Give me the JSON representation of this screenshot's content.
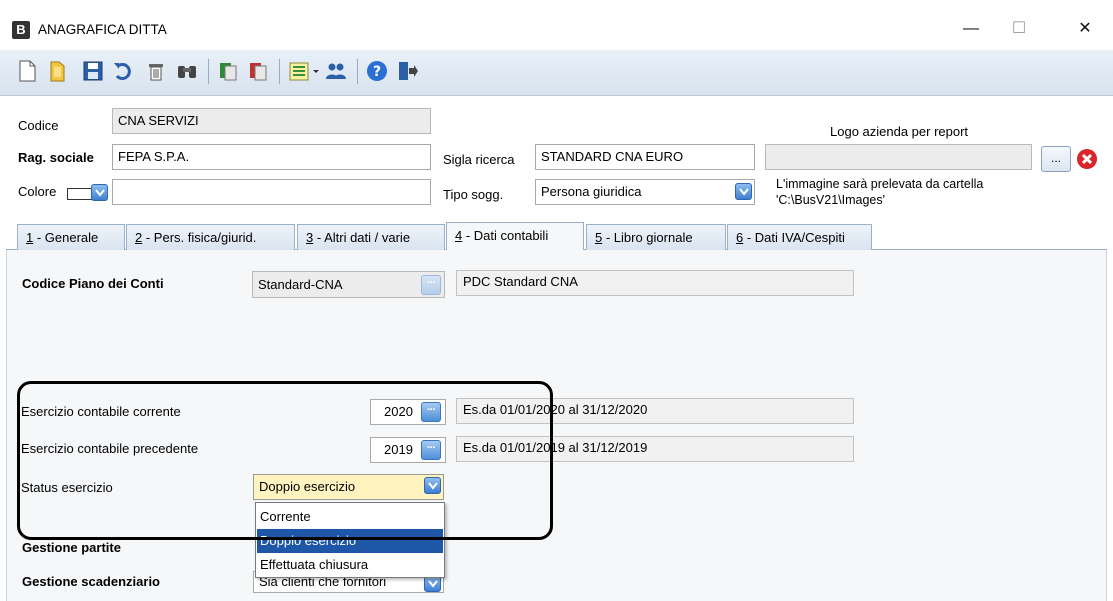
{
  "window": {
    "title": "ANAGRAFICA DITTA",
    "app_icon_letter": "B",
    "minimize": "—",
    "maximize": "☐",
    "close": "✕"
  },
  "toolbar": {
    "icons": [
      "new-icon",
      "open-icon",
      "save-icon",
      "undo-icon",
      "delete-icon",
      "find-icon",
      "copy-icon",
      "paste-icon",
      "list-icon",
      "users-icon",
      "help-icon",
      "exit-icon"
    ]
  },
  "header": {
    "codice_label": "Codice",
    "codice_value": "CNA SERVIZI",
    "rag_sociale_label": "Rag. sociale",
    "rag_sociale_value": "FEPA S.P.A.",
    "colore_label": "Colore",
    "colore_value": "",
    "sigla_label": "Sigla ricerca",
    "sigla_value": "STANDARD CNA EURO",
    "tipo_label": "Tipo sogg.",
    "tipo_value": "Persona giuridica",
    "logo_label": "Logo azienda per report",
    "logo_value": "",
    "logo_browse": "...",
    "logo_note_line1": "L'immagine sarà prelevata da cartella",
    "logo_note_line2": "'C:\\BusV21\\Images'"
  },
  "tabs": [
    {
      "num": "1",
      "label": " - Generale"
    },
    {
      "num": "2",
      "label": " - Pers. fisica/giurid."
    },
    {
      "num": "3",
      "label": " - Altri dati / varie"
    },
    {
      "num": "4",
      "label": " - Dati contabili"
    },
    {
      "num": "5",
      "label": " - Libro giornale"
    },
    {
      "num": "6",
      "label": " - Dati IVA/Cespiti"
    }
  ],
  "active_tab": 4,
  "panel": {
    "piano_label": "Codice Piano dei Conti",
    "piano_value": "Standard-CNA",
    "piano_desc": "PDC Standard CNA",
    "corrente_label": "Esercizio contabile corrente",
    "corrente_value": "2020",
    "corrente_desc": "Es.da 01/01/2020 al 31/12/2020",
    "precedente_label": "Esercizio contabile precedente",
    "precedente_value": "2019",
    "precedente_desc": "Es.da 01/01/2019 al 31/12/2019",
    "status_label": "Status esercizio",
    "status_value": "Doppio esercizio",
    "partite_label": "Gestione partite",
    "scadenziario_label": "Gestione scadenziario",
    "scadenziario_value": "Sia clienti che fornitori"
  },
  "dropdown": {
    "options": [
      "Corrente",
      "Doppio esercizio",
      "Effettuata chiusura"
    ],
    "selected_index": 1
  },
  "colors": {
    "accent": "#1e56a8",
    "combo_blue": "#3d7fd0",
    "yellow_field": "#fff3c0",
    "delete_red": "#d8262c"
  }
}
